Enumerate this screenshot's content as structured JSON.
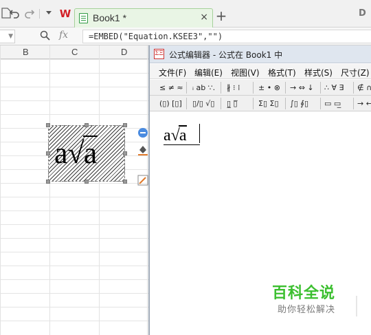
{
  "titlebar": {
    "save_icon": "save-icon",
    "undo_icon": "undo-icon",
    "redo_icon": "redo-icon",
    "dropdown_icon": "dropdown-icon",
    "app_logo": "W",
    "tab_label": "Book1 *",
    "tab_close": "×",
    "new_tab": "+",
    "right_glyph": "D"
  },
  "formula_bar": {
    "fx": "fx",
    "formula": "=EMBED(\"Equation.KSEE3\",\"\")"
  },
  "grid": {
    "columns": [
      "B",
      "C",
      "D"
    ]
  },
  "embedded_object": {
    "prefix": "a",
    "radicand": "a"
  },
  "equation_editor": {
    "title": "公式编辑器 - 公式在 Book1 中",
    "app_icon": "ΣΞ",
    "menu": [
      "文件(F)",
      "编辑(E)",
      "视图(V)",
      "格式(T)",
      "样式(S)",
      "尺寸(Z)"
    ],
    "palette_row1": [
      "≤ ≠ ≈",
      "ᵢ ab ∵.",
      "∦ ⁝ ⁞",
      "± • ⊗",
      "→ ⇔ ↓",
      "∴ ∀ ∃",
      "∉ ∩"
    ],
    "palette_row2": [
      "(▯) [▯]",
      "▯/▯ √▯",
      "▯̲ ▯̅",
      "Σ▯ Σ▯",
      "∫▯ ∮▯",
      "▭ ▭̲",
      "→ ←"
    ],
    "equation_prefix": "a",
    "equation_radicand": "a"
  },
  "watermark": {
    "title": "百科全说",
    "subtitle": "助你轻松解决"
  }
}
